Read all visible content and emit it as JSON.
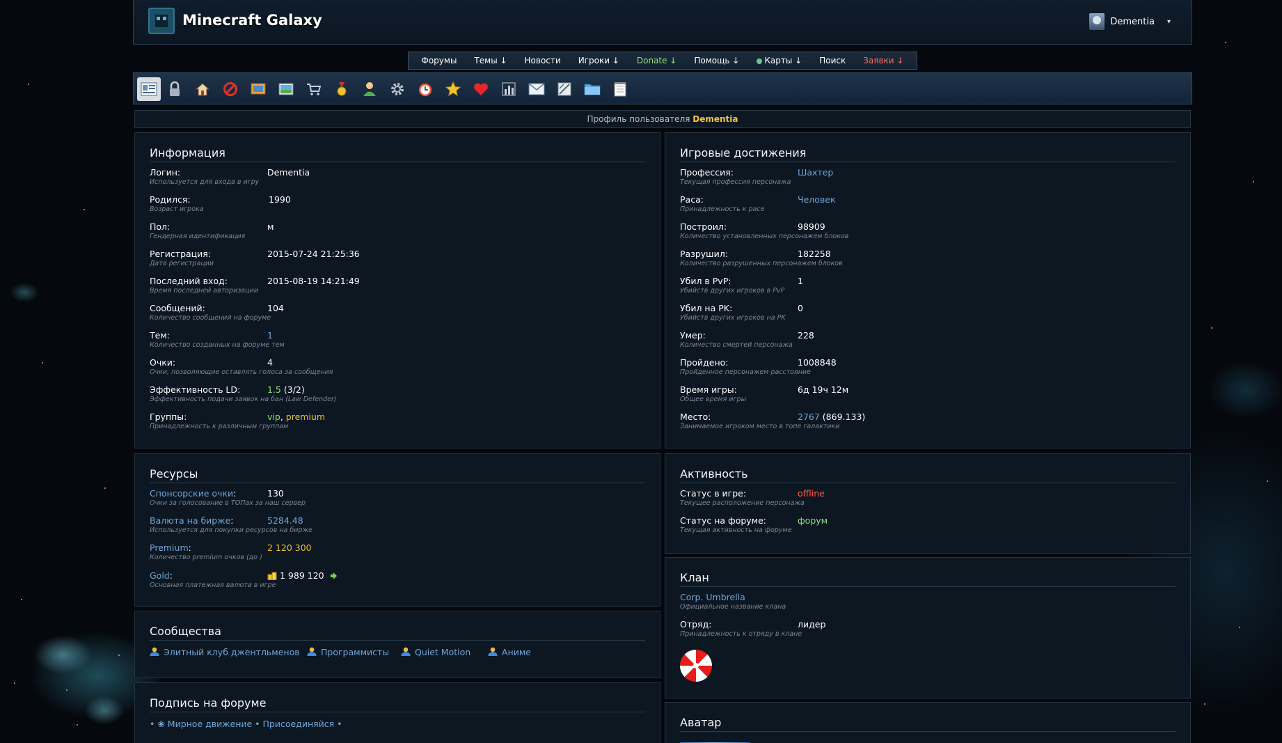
{
  "site": {
    "title": "Minecraft Galaxy",
    "user": "Dementia",
    "caret": "▾"
  },
  "nav": [
    {
      "label": "Форумы"
    },
    {
      "label": "Темы ↓"
    },
    {
      "label": "Новости"
    },
    {
      "label": "Игроки ↓"
    },
    {
      "label": "Donate ↓"
    },
    {
      "label": "Помощь ↓"
    },
    {
      "label": "Карты ↓"
    },
    {
      "label": "Поиск"
    },
    {
      "label": "Заявки ↓"
    }
  ],
  "toolbar_icons": [
    "profile-card-icon",
    "lock-icon",
    "home-icon",
    "ban-icon",
    "screen-icon",
    "picture-icon",
    "cart-icon",
    "medal-icon",
    "user-icon",
    "gear-icon",
    "alarm-icon",
    "star-icon",
    "heart-icon",
    "chart-icon",
    "mail-icon",
    "document-icon",
    "folder-icon",
    "notepad-icon"
  ],
  "header": {
    "prefix": "Профиль пользователя",
    "name": "Dementia"
  },
  "info": {
    "title": "Информация",
    "rows": [
      {
        "label": "Логин:",
        "value": "Dementia",
        "hint": "Используется для входа в игру"
      },
      {
        "label": "Родился:",
        "value": "1990",
        "hint": "Возраст игрока"
      },
      {
        "label": "Пол:",
        "value": "м",
        "hint": "Гендерная идентификация"
      },
      {
        "label": "Регистрация:",
        "value": "2015-07-24 21:25:36",
        "hint": "Дата регистрации"
      },
      {
        "label": "Последний вход:",
        "value": "2015-08-19 14:21:49",
        "hint": "Время последней авторизации"
      },
      {
        "label": "Сообщений:",
        "value": "104",
        "hint": "Количество сообщений на форуме"
      },
      {
        "label": "Тем:",
        "value": "1",
        "hint": "Количество созданных на форуме тем"
      },
      {
        "label": "Очки:",
        "value": "4",
        "hint": "Очки, позволяющие оставлять голоса за сообщения"
      },
      {
        "label": "Эффективность LD:",
        "value": "1.5",
        "value2": "(3/2)",
        "hint": "Эффективность подачи заявок на бан (Law Defender)"
      },
      {
        "label": "Группы:",
        "value": "vip",
        "value2": "premium",
        "hint": "Принадлежность к различным группам"
      }
    ]
  },
  "achievements": {
    "title": "Игровые достижения",
    "rows": [
      {
        "label": "Профессия:",
        "value": "Шахтер",
        "hint": "Текущая профессия персонажа"
      },
      {
        "label": "Раса:",
        "value": "Человек",
        "hint": "Принадлежность к расе"
      },
      {
        "label": "Построил:",
        "value": "98909",
        "hint": "Количество установленных персонажем блоков"
      },
      {
        "label": "Разрушил:",
        "value": "182258",
        "hint": "Количество разрушенных персонажем блоков"
      },
      {
        "label": "Убил в PvP:",
        "value": "1",
        "hint": "Убийств других игроков в PvP"
      },
      {
        "label": "Убил на PK:",
        "value": "0",
        "hint": "Убийств других игроков на PK"
      },
      {
        "label": "Умер:",
        "value": "228",
        "hint": "Количество смертей персонажа"
      },
      {
        "label": "Пройдено:",
        "value": "1008848",
        "hint": "Пройденное персонажем расстояние"
      },
      {
        "label": "Время игры:",
        "value": "6д 19ч 12м",
        "hint": "Общее время игры"
      },
      {
        "label": "Место:",
        "value": "2767",
        "value2": "(869.133)",
        "hint": "Занимаемое игроком место в топе галактики"
      }
    ]
  },
  "resources": {
    "title": "Ресурсы",
    "rows": [
      {
        "label": "Спонсорские очки",
        "colon": ":",
        "value": "130",
        "hint": "Очки за голосование в ТОПах за наш сервер"
      },
      {
        "label": "Валюта на бирже",
        "colon": ":",
        "value": "5284.48",
        "hint": "Используется для покупки ресурсов на бирже"
      },
      {
        "label": "Premium",
        "colon": ":",
        "value": "2 120 300",
        "hint": "Количество premium очков (до )"
      },
      {
        "label": "Gold",
        "colon": ":",
        "value": "1 989 120",
        "hint": "Основная платежная валюта в игре"
      }
    ]
  },
  "activity": {
    "title": "Активность",
    "rows": [
      {
        "label": "Статус в игре:",
        "value": "offline",
        "hint": "Текущее расположение персонажа"
      },
      {
        "label": "Статус на форуме:",
        "value": "форум",
        "hint": "Текущая активность на форуме"
      }
    ]
  },
  "communities": {
    "title": "Сообщества",
    "items": [
      "Элитный клуб джентльменов",
      "Программисты",
      "Quiet Motion",
      "Аниме"
    ]
  },
  "clan": {
    "title": "Клан",
    "name": "Corp. Umbrella",
    "name_hint": "Официальное название клана",
    "squad_label": "Отряд:",
    "squad_value": "лидер",
    "squad_hint": "Принадлежность к отряду в клане"
  },
  "signature": {
    "title": "Подпись на форуме",
    "text": "• ❀ Мирное движение • Присоединяйся •"
  },
  "avatar": {
    "title": "Аватар"
  },
  "colors": {
    "accent_yellow": "#f0c22e",
    "link_blue": "#6fa6d8",
    "green": "#8be07a",
    "red": "#ff5a4a"
  }
}
